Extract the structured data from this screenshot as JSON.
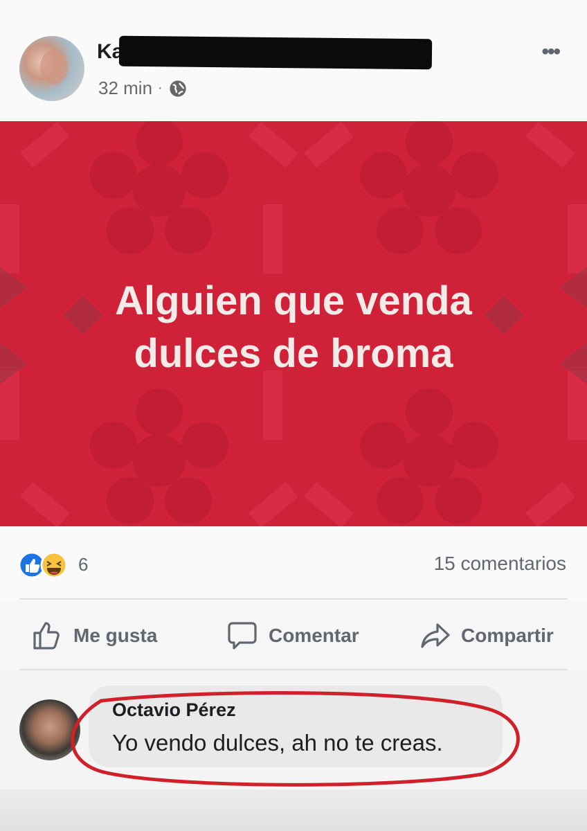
{
  "post": {
    "author_name_visible": "Ka",
    "timestamp": "32 min",
    "separator": "·",
    "privacy_icon": "globe-icon",
    "more_icon": "more-options-icon",
    "text_line1": "Alguien que venda",
    "text_line2": "dulces de broma",
    "background_color": "#cf2239"
  },
  "reactions": {
    "icons": [
      "like-reaction-icon",
      "haha-reaction-icon"
    ],
    "count": "6",
    "comments_count_label": "15 comentarios"
  },
  "actions": {
    "like_label": "Me gusta",
    "comment_label": "Comentar",
    "share_label": "Compartir"
  },
  "comment": {
    "author": "Octavio Pérez",
    "text": "Yo vendo dulces, ah no te creas.",
    "highlight_color": "#d0202a"
  }
}
